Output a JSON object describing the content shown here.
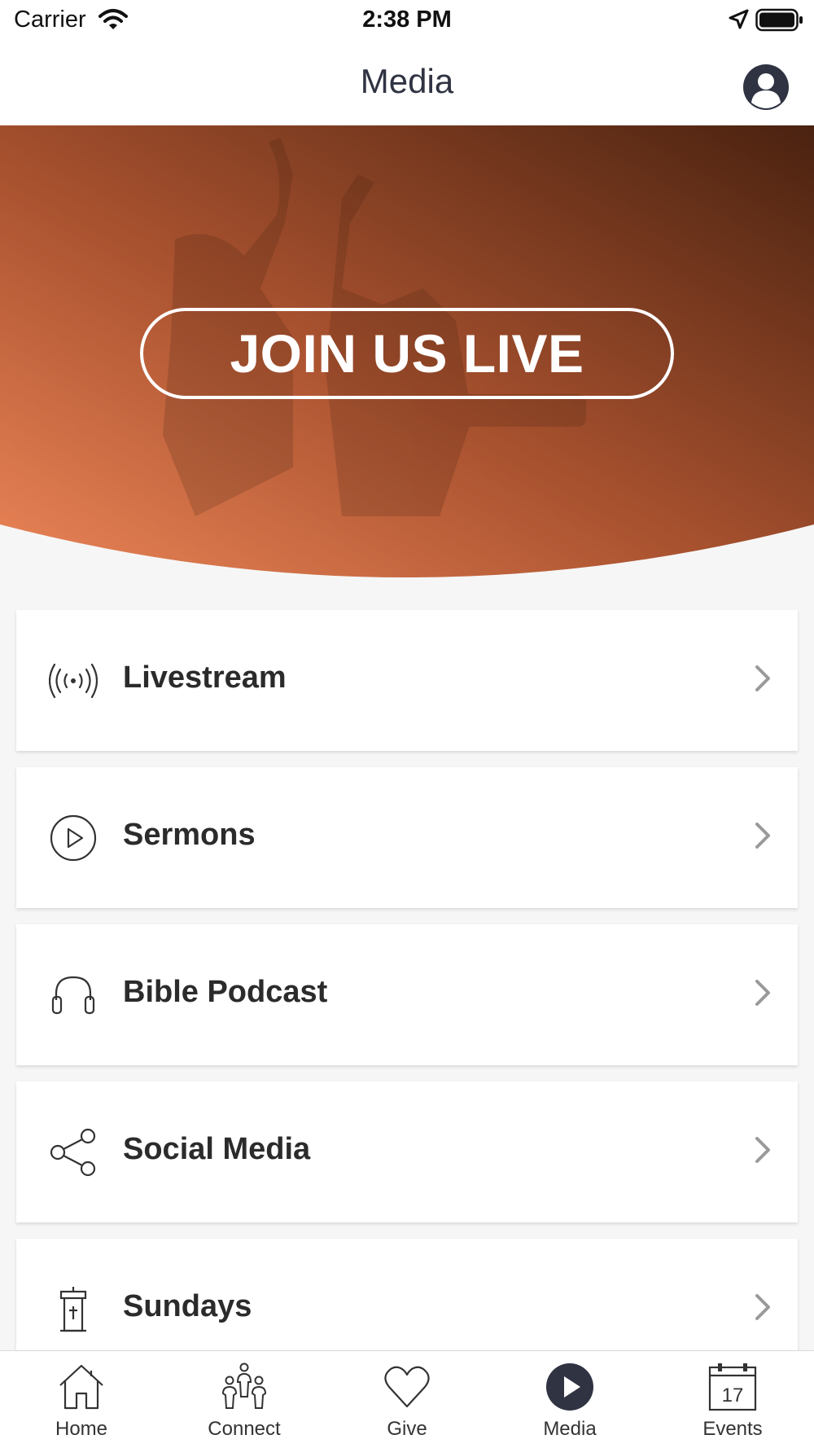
{
  "status_bar": {
    "carrier": "Carrier",
    "time": "2:38 PM"
  },
  "nav": {
    "title": "Media"
  },
  "hero": {
    "cta_label": "JOIN US LIVE"
  },
  "menu": [
    {
      "label": "Livestream",
      "icon": "broadcast-icon"
    },
    {
      "label": "Sermons",
      "icon": "play-circle-icon"
    },
    {
      "label": "Bible Podcast",
      "icon": "headphones-icon"
    },
    {
      "label": "Social Media",
      "icon": "share-icon"
    },
    {
      "label": "Sundays",
      "icon": "pulpit-icon"
    }
  ],
  "tabs": [
    {
      "label": "Home",
      "icon": "home-icon"
    },
    {
      "label": "Connect",
      "icon": "people-icon"
    },
    {
      "label": "Give",
      "icon": "heart-icon"
    },
    {
      "label": "Media",
      "icon": "play-icon",
      "active": true
    },
    {
      "label": "Events",
      "icon": "calendar-icon",
      "date": "17"
    }
  ],
  "colors": {
    "accent": "#e8825a",
    "hero_dark": "#4a2210",
    "nav_text": "#2f3342"
  }
}
